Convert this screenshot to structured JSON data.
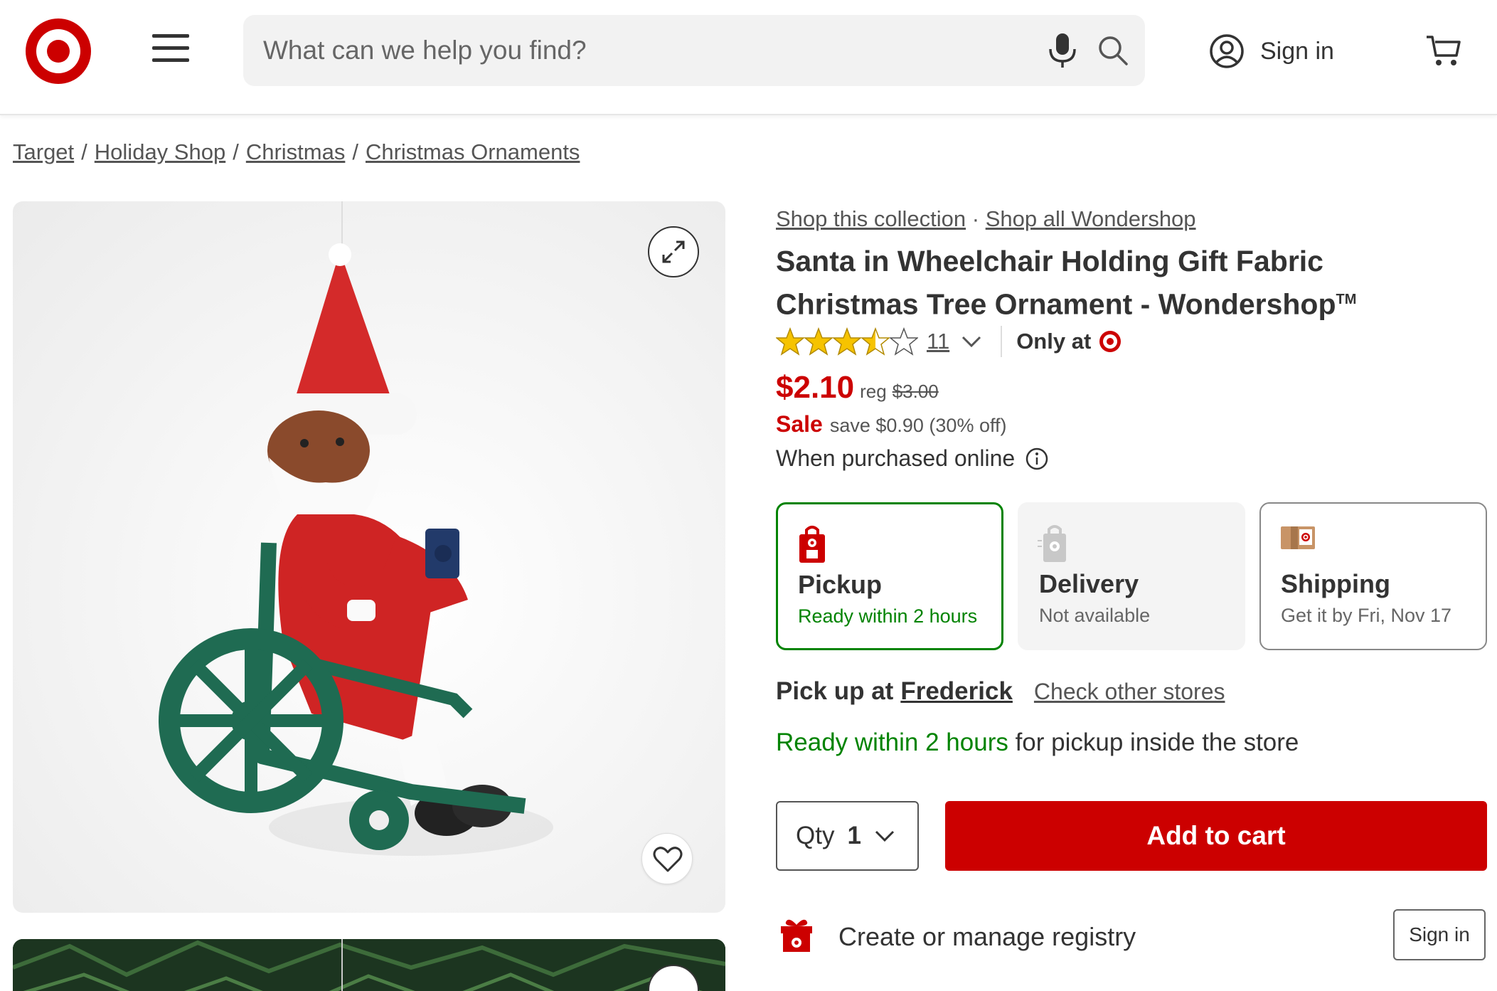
{
  "header": {
    "search_placeholder": "What can we help you find?",
    "signin_label": "Sign in",
    "brand_color": "#cc0000"
  },
  "breadcrumb": [
    "Target",
    "Holiday Shop",
    "Christmas",
    "Christmas Ornaments"
  ],
  "product": {
    "shop_collection": "Shop this collection",
    "shop_all": "Shop all Wondershop",
    "collection_sep": "·",
    "title": "Santa in Wheelchair Holding Gift Fabric Christmas Tree Ornament - Wondershop",
    "trademark": "TM",
    "rating": 3.5,
    "rating_max": 5,
    "rating_count": "11",
    "only_at": "Only at",
    "price": "$2.10",
    "reg_label": "reg",
    "reg_price": "$3.00",
    "sale_label": "Sale",
    "save_text": "save $0.90 (30% off)",
    "online_note": "When purchased online"
  },
  "fulfillment": [
    {
      "name": "Pickup",
      "sub": "Ready within 2 hours",
      "state": "selected"
    },
    {
      "name": "Delivery",
      "sub": "Not available",
      "state": "disabled"
    },
    {
      "name": "Shipping",
      "sub": "Get it by Fri, Nov 17",
      "state": "available"
    }
  ],
  "pickup": {
    "prefix": "Pick up at",
    "store": "Frederick",
    "other_stores": "Check other stores",
    "ready_green": "Ready within 2 hours",
    "ready_rest": " for pickup inside the store"
  },
  "cart": {
    "qty_label": "Qty",
    "qty_value": "1",
    "add_label": "Add to cart"
  },
  "registry": {
    "text": "Create or manage registry",
    "button": "Sign in"
  },
  "colors": {
    "red": "#cc0000",
    "green": "#008300",
    "star": "#f6c300"
  }
}
